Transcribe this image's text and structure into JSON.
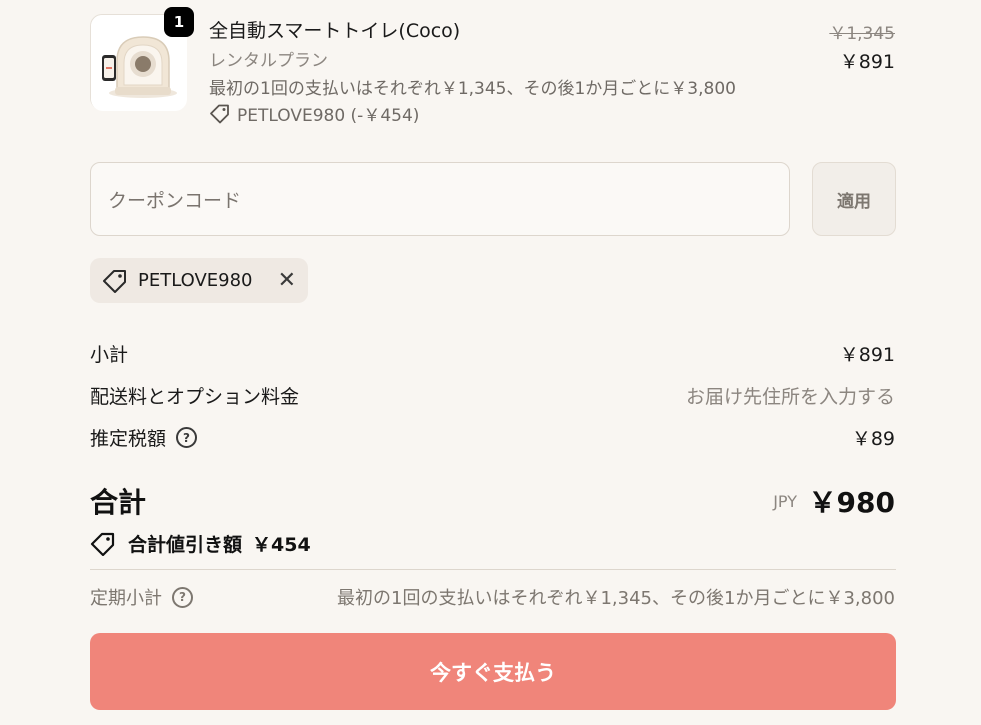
{
  "product": {
    "quantity": "1",
    "title": "全自動スマートトイレ(Coco)",
    "plan": "レンタルプラン",
    "description": "最初の1回の支払いはそれぞれ￥1,345、その後1か月ごとに￥3,800",
    "discount": "PETLOVE980 (-￥454)",
    "original_price": "￥1,345",
    "price": "￥891"
  },
  "coupon": {
    "placeholder": "クーポンコード",
    "apply_label": "適用",
    "applied_code": "PETLOVE980"
  },
  "summary": {
    "subtotal_label": "小計",
    "subtotal_value": "￥891",
    "shipping_label": "配送料とオプション料金",
    "shipping_value": "お届け先住所を入力する",
    "tax_label": "推定税額",
    "tax_value": "￥89",
    "total_label": "合計",
    "currency": "JPY",
    "total_value": "￥980",
    "savings_label": "合計値引き額",
    "savings_value": "￥454",
    "recurring_label": "定期小計",
    "recurring_value": "最初の1回の支払いはそれぞれ￥1,345、その後1か月ごとに￥3,800"
  },
  "pay_button_label": "今すぐ支払う",
  "colors": {
    "background": "#f9f6f2",
    "pay_button": "#f0857a"
  }
}
